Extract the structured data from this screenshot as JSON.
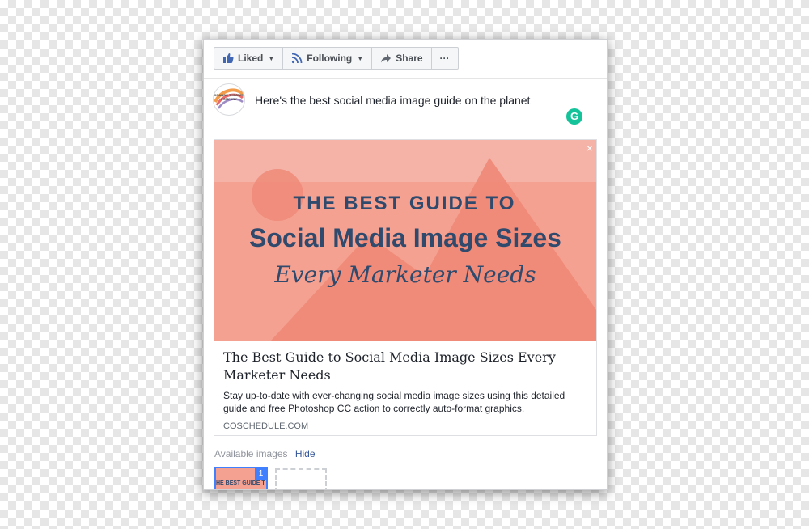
{
  "toolbar": {
    "liked_label": "Liked",
    "following_label": "Following",
    "share_label": "Share",
    "more_label": "···"
  },
  "page_avatar": {
    "text": "ORANGE THEATER COMPANY"
  },
  "post": {
    "text": "Here's the best social media image guide on the planet"
  },
  "grammarly": {
    "glyph": "G"
  },
  "link_preview": {
    "image_line1": "THE BEST GUIDE TO",
    "image_line2": "Social Media Image Sizes",
    "image_line3": "Every Marketer Needs",
    "title": "The Best Guide to Social Media Image Sizes Every Marketer Needs",
    "description": "Stay up-to-date with ever-changing social media image sizes using this detailed guide and free Photoshop CC action to correctly auto-format graphics.",
    "domain": "COSCHEDULE.COM",
    "close_glyph": "×"
  },
  "images_picker": {
    "label": "Available images",
    "hide_label": "Hide",
    "thumb1_badge": "1",
    "thumb1_text": "HE BEST GUIDE T"
  },
  "colors": {
    "link_blue": "#365899",
    "accent_blue": "#4080ff",
    "hero_pink": "#f5a191",
    "hero_navy": "#2f4a6d",
    "grammarly_green": "#15c39a"
  }
}
